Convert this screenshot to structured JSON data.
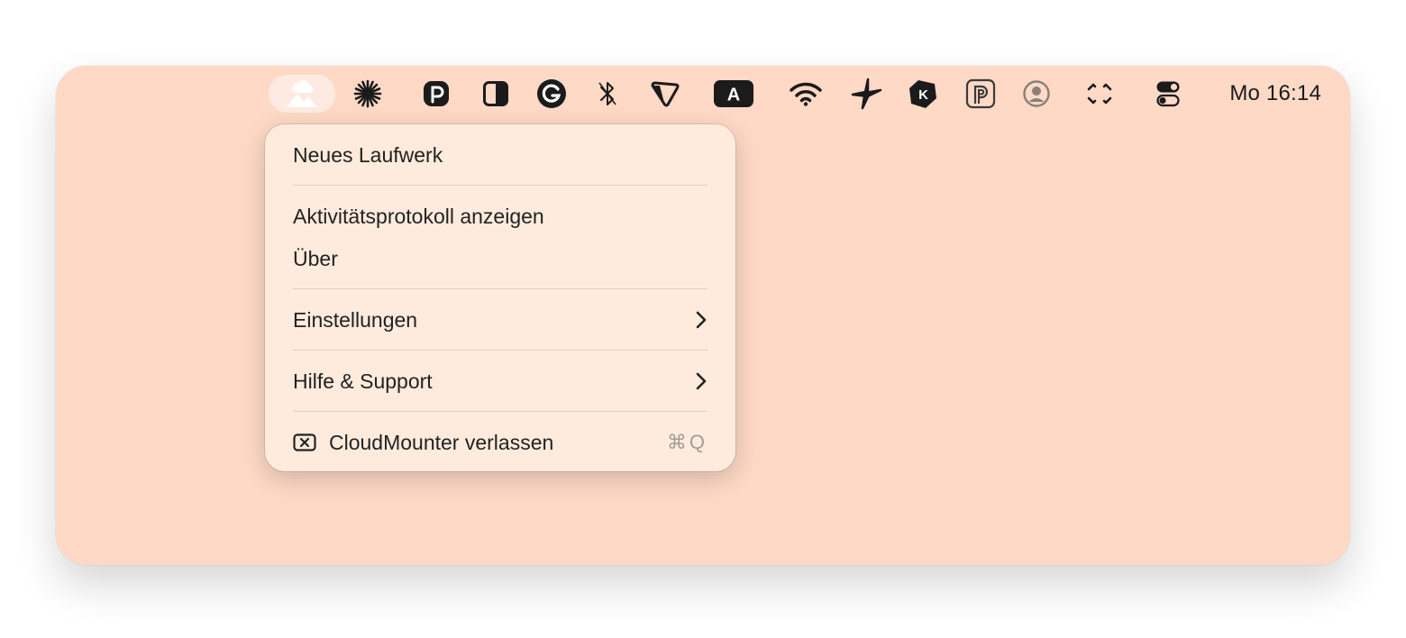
{
  "menubar": {
    "items": [
      {
        "icon": "cloudmounter-icon",
        "active": true
      },
      {
        "icon": "asterisk-burst-icon"
      },
      {
        "icon": "p-circle-app-icon"
      },
      {
        "icon": "half-contrast-icon"
      },
      {
        "icon": "grammarly-icon"
      },
      {
        "icon": "bluetooth-icon"
      },
      {
        "icon": "pointer-shape-icon"
      },
      {
        "icon": "input-source-icon",
        "label": "A"
      },
      {
        "icon": "wifi-icon"
      },
      {
        "icon": "pinwheel-icon"
      },
      {
        "icon": "k-hexagon-icon",
        "label": "K"
      },
      {
        "icon": "p-square-icon"
      },
      {
        "icon": "user-account-icon"
      },
      {
        "icon": "screen-capture-icon"
      },
      {
        "icon": "control-center-icon"
      }
    ],
    "clock": "Mo 16:14"
  },
  "menu": {
    "items": [
      {
        "label": "Neues Laufwerk"
      },
      {
        "label": "Aktivitätsprotokoll anzeigen"
      },
      {
        "label": "Über"
      },
      {
        "label": "Einstellungen",
        "submenu": true
      },
      {
        "label": "Hilfe & Support",
        "submenu": true
      },
      {
        "label": "CloudMounter verlassen",
        "shortcut": "⌘Q",
        "icon": "quit-icon"
      }
    ]
  },
  "colors": {
    "desktop": "#fdd9c6",
    "menu_background": "#ffebdd",
    "text": "#222222",
    "shortcut_text": "#a59c95"
  }
}
